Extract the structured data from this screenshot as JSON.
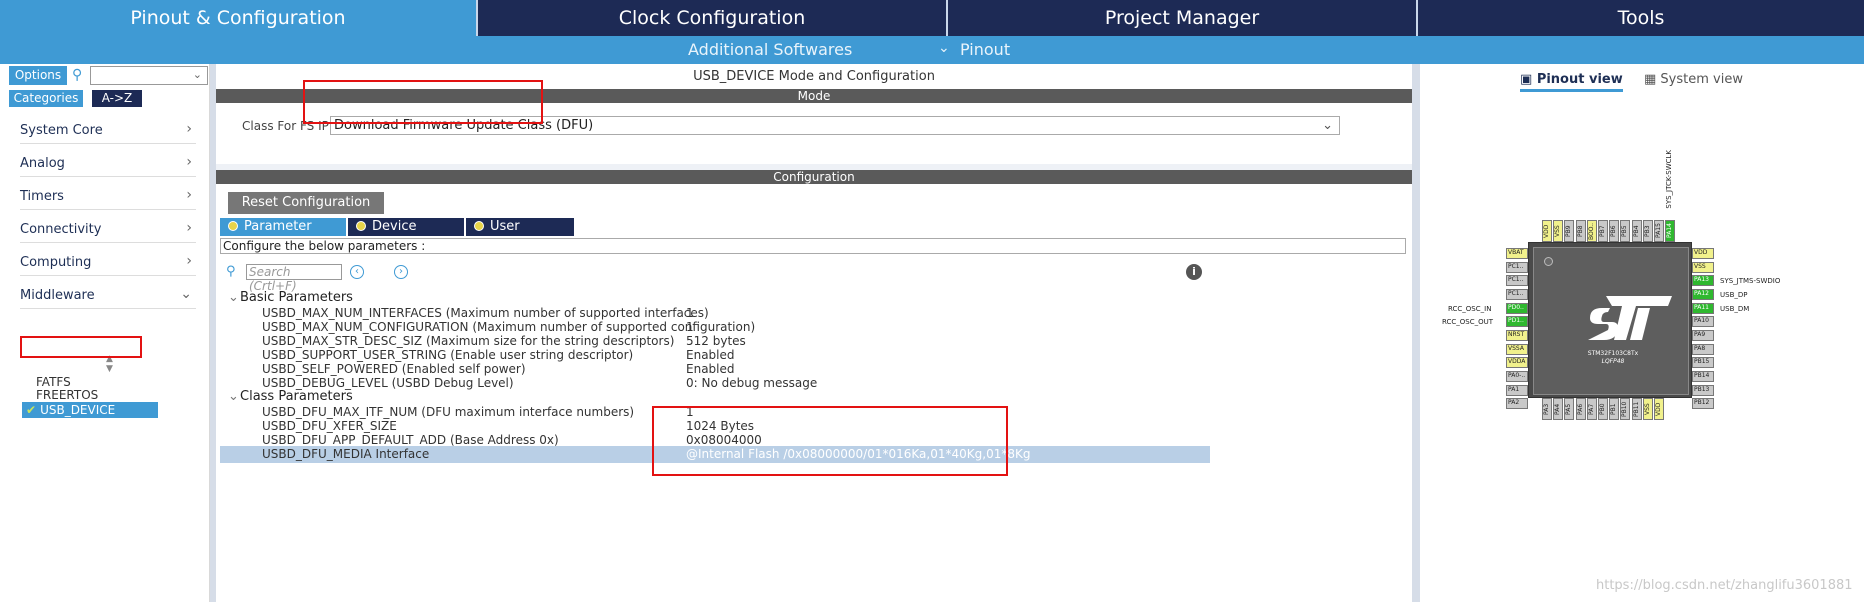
{
  "top_tabs": [
    "Pinout & Configuration",
    "Clock Configuration",
    "Project Manager",
    "Tools"
  ],
  "sub_bar": {
    "additional": "Additional Softwares",
    "pinout": "Pinout"
  },
  "sidebar": {
    "options": "Options",
    "categories": "Categories",
    "az": "A->Z",
    "items": [
      "System Core",
      "Analog",
      "Timers",
      "Connectivity",
      "Computing",
      "Middleware"
    ],
    "middleware": [
      "FATFS",
      "FREERTOS",
      "USB_DEVICE"
    ]
  },
  "center": {
    "title": "USB_DEVICE Mode and Configuration",
    "mode_header": "Mode",
    "class_label": "Class For FS IP",
    "class_value": "Download Firmware Update Class (DFU)",
    "config_header": "Configuration",
    "reset_button": "Reset Configuration",
    "tabs": [
      "Parameter Settings",
      "Device Descriptor",
      "User Constants"
    ],
    "configure_text": "Configure the below parameters :",
    "search_placeholder": "Search (Crtl+F)",
    "groups": [
      "Basic Parameters",
      "Class Parameters"
    ],
    "basic_params": [
      {
        "name": "USBD_MAX_NUM_INTERFACES (Maximum number of supported interfaces)",
        "value": "1"
      },
      {
        "name": "USBD_MAX_NUM_CONFIGURATION (Maximum number of supported configuration)",
        "value": "1"
      },
      {
        "name": "USBD_MAX_STR_DESC_SIZ (Maximum size for the string descriptors)",
        "value": "512 bytes"
      },
      {
        "name": "USBD_SUPPORT_USER_STRING (Enable user string descriptor)",
        "value": "Enabled"
      },
      {
        "name": "USBD_SELF_POWERED (Enabled self power)",
        "value": "Enabled"
      },
      {
        "name": "USBD_DEBUG_LEVEL (USBD Debug Level)",
        "value": "0: No debug message"
      }
    ],
    "class_params": [
      {
        "name": "USBD_DFU_MAX_ITF_NUM (DFU maximum interface numbers)",
        "value": "1"
      },
      {
        "name": "USBD_DFU_XFER_SIZE",
        "value": "1024 Bytes"
      },
      {
        "name": "USBD_DFU_APP_DEFAULT_ADD (Base Address 0x)",
        "value": "0x08004000"
      },
      {
        "name": "USBD_DFU_MEDIA Interface",
        "value": "@Internal Flash   /0x08000000/01*016Ka,01*40Kg,01*8Kg"
      }
    ]
  },
  "right": {
    "tabs": [
      "Pinout view",
      "System view"
    ],
    "chip_name": "STM32F103C8Tx",
    "chip_package": "LQFP48",
    "top_pins": [
      "VDD",
      "VSS",
      "PB9",
      "PB8",
      "BOO..",
      "PB7",
      "PB6",
      "PB5",
      "PB4",
      "PB3",
      "PA15",
      "PA14"
    ],
    "bottom_pins": [
      "PA3",
      "PA4",
      "PA5",
      "PA6",
      "PA7",
      "PB0",
      "PB1",
      "PB10",
      "PB11",
      "VSS",
      "VDD"
    ],
    "left_pins": [
      "VBAT",
      "PC1..",
      "PC1..",
      "PC1..",
      "PD0..",
      "PD1..",
      "NRST",
      "VSSA",
      "VDDA",
      "PA0-..",
      "PA1",
      "PA2"
    ],
    "right_pins": [
      "VDD",
      "VSS",
      "PA13",
      "PA12",
      "PA11",
      "PA10",
      "PA9",
      "PA8",
      "PB15",
      "PB14",
      "PB13",
      "PB12"
    ],
    "label_top": "SYS_JTCK-SWCLK",
    "label_pa13": "SYS_JTMS-SWDIO",
    "label_pa12": "USB_DP",
    "label_pa11": "USB_DM",
    "label_pd0": "RCC_OSC_IN",
    "label_pd1": "RCC_OSC_OUT"
  },
  "watermark": "https://blog.csdn.net/zhanglifu3601881"
}
